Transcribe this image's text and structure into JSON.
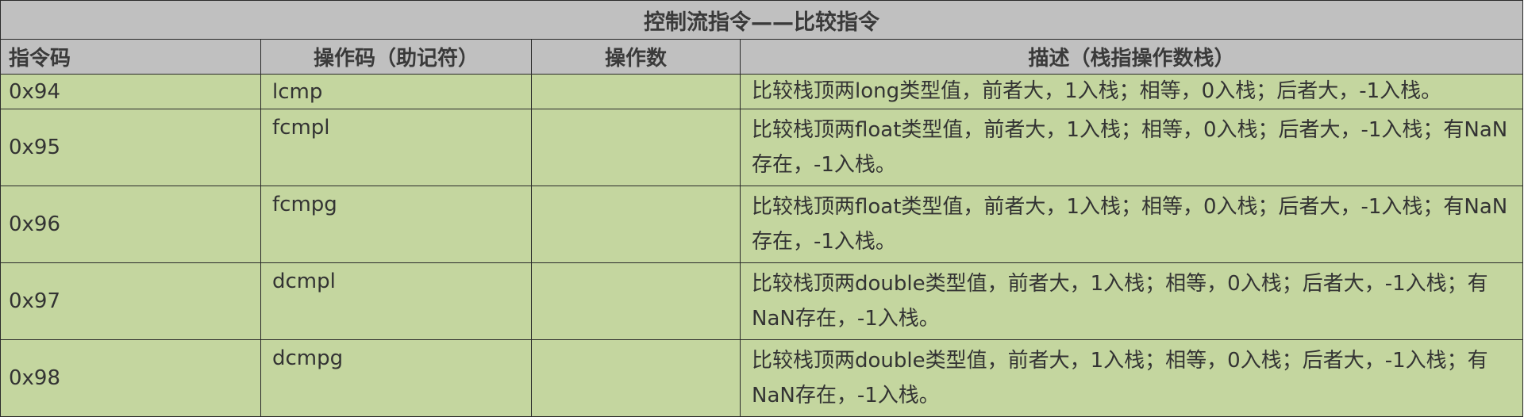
{
  "table": {
    "title": "控制流指令——比较指令",
    "headers": [
      "指令码",
      "操作码（助记符）",
      "操作数",
      "描述（栈指操作数栈）"
    ],
    "rows": [
      {
        "code": "0x94",
        "mnemonic": "lcmp",
        "operand": "",
        "description": "比较栈顶两long类型值，前者大，1入栈；相等，0入栈；后者大，-1入栈。"
      },
      {
        "code": "0x95",
        "mnemonic": "fcmpl",
        "operand": "",
        "description": "比较栈顶两float类型值，前者大，1入栈；相等，0入栈；后者大，-1入栈；有NaN存在，-1入栈。"
      },
      {
        "code": "0x96",
        "mnemonic": "fcmpg",
        "operand": "",
        "description": "比较栈顶两float类型值，前者大，1入栈；相等，0入栈；后者大，-1入栈；有NaN存在，-1入栈。"
      },
      {
        "code": "0x97",
        "mnemonic": "dcmpl",
        "operand": "",
        "description": "比较栈顶两double类型值，前者大，1入栈；相等，0入栈；后者大，-1入栈；有NaN存在，-1入栈。"
      },
      {
        "code": "0x98",
        "mnemonic": "dcmpg",
        "operand": "",
        "description": "比较栈顶两double类型值，前者大，1入栈；相等，0入栈；后者大，-1入栈；有NaN存在，-1入栈。"
      }
    ]
  },
  "colors": {
    "header_bg": "#c0c0c0",
    "row_bg": "#c4d69f",
    "border": "#2a2a2a",
    "text": "#333333"
  }
}
